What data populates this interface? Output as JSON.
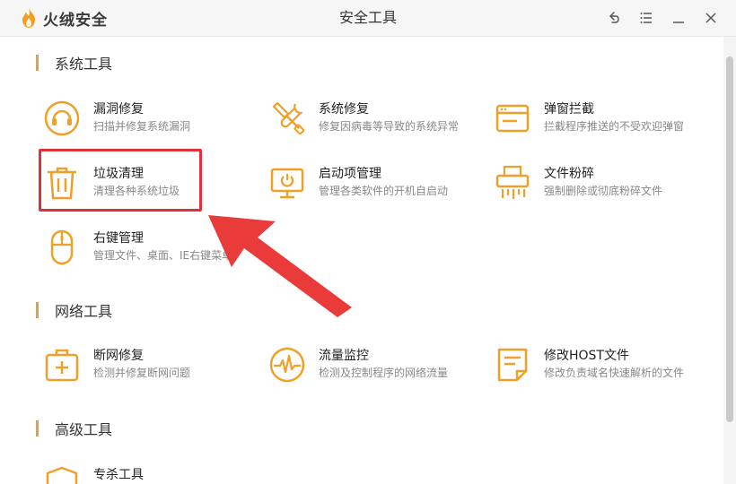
{
  "app": {
    "brand": "火绒安全",
    "window_title": "安全工具",
    "colors": {
      "accent": "#f0a028",
      "highlight": "#e0303a",
      "section_bar": "#c8a579"
    }
  },
  "window_controls": [
    {
      "icon": "back-icon"
    },
    {
      "icon": "menu-icon"
    },
    {
      "icon": "minimize-icon"
    },
    {
      "icon": "close-icon"
    }
  ],
  "sections": {
    "system": {
      "title": "系统工具",
      "tools": [
        {
          "name": "漏洞修复",
          "desc": "扫描并修复系统漏洞",
          "icon": "vulnerability-fix-icon"
        },
        {
          "name": "系统修复",
          "desc": "修复因病毒等导致的系统异常",
          "icon": "system-repair-icon"
        },
        {
          "name": "弹窗拦截",
          "desc": "拦截程序推送的不受欢迎弹窗",
          "icon": "popup-block-icon"
        },
        {
          "name": "垃圾清理",
          "desc": "清理各种系统垃圾",
          "icon": "trash-icon"
        },
        {
          "name": "启动项管理",
          "desc": "管理各类软件的开机自启动",
          "icon": "startup-icon"
        },
        {
          "name": "文件粉碎",
          "desc": "强制删除或彻底粉碎文件",
          "icon": "shredder-icon"
        },
        {
          "name": "右键管理",
          "desc": "管理文件、桌面、IE右键菜单",
          "icon": "mouse-icon"
        }
      ]
    },
    "network": {
      "title": "网络工具",
      "tools": [
        {
          "name": "断网修复",
          "desc": "检测并修复断网问题",
          "icon": "network-repair-icon"
        },
        {
          "name": "流量监控",
          "desc": "检测及控制程序的网络流量",
          "icon": "traffic-monitor-icon"
        },
        {
          "name": "修改HOST文件",
          "desc": "修改负责域名快速解析的文件",
          "icon": "host-file-icon"
        }
      ]
    },
    "advanced": {
      "title": "高级工具",
      "tools": [
        {
          "name": "专杀工具",
          "desc": "",
          "icon": "shield-icon"
        }
      ]
    }
  }
}
